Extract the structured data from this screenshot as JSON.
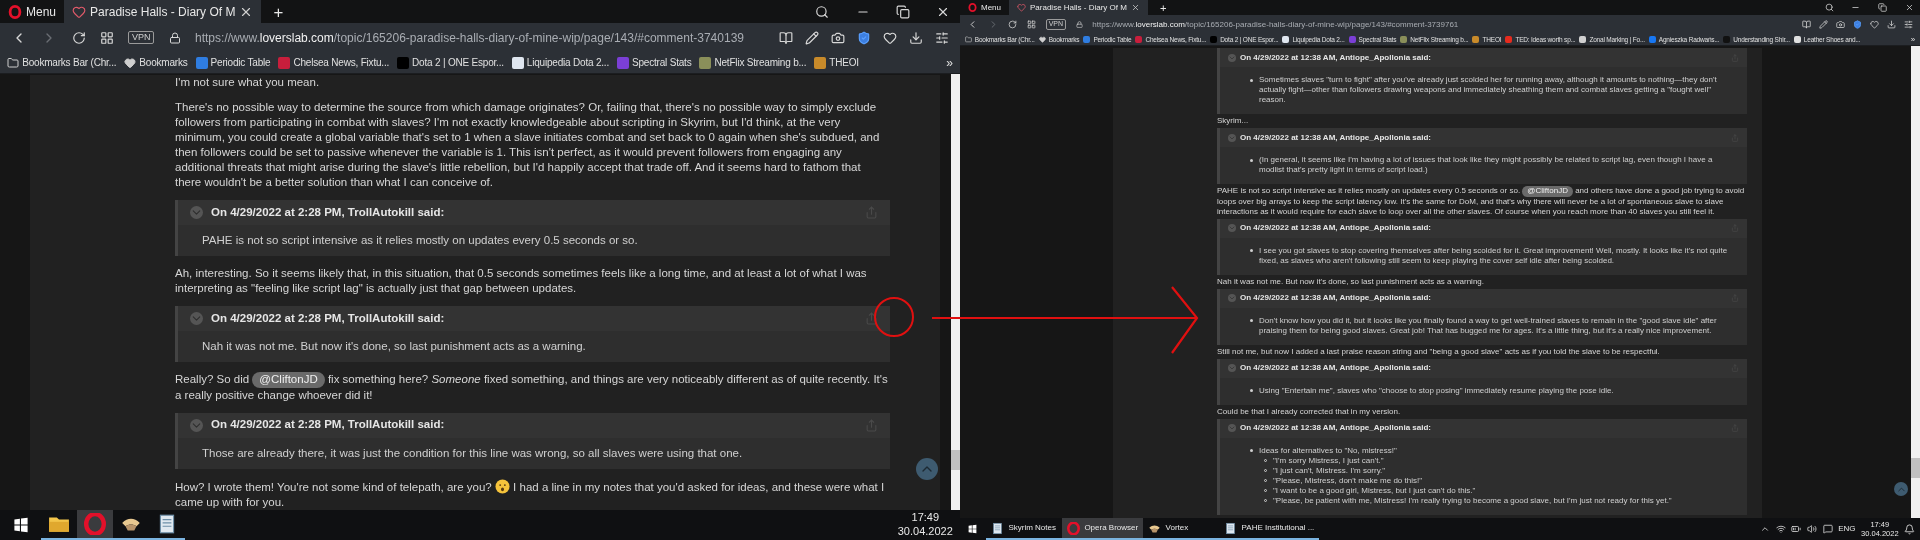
{
  "panes": [
    {
      "menu": "Menu",
      "tab": {
        "title": "Paradise Halls - Diary Of M",
        "selected": true
      },
      "new_tab": "+",
      "vpn": "VPN",
      "url": "https://www.**loverslab.com**/topic/165206-paradise-halls-diary-of-mine-wip/page/143/#comment-3740139",
      "bookmarks": [
        {
          "label": "Bookmarks Bar (Chr...",
          "kind": "folder"
        },
        {
          "label": "Bookmarks",
          "kind": "heart"
        },
        {
          "label": "Periodic Table",
          "kind": "favicon",
          "color": "#2f7de1"
        },
        {
          "label": "Chelsea News, Fixtu...",
          "kind": "favicon",
          "color": "#c81e3c"
        },
        {
          "label": "Dota 2 | ONE Espor...",
          "kind": "favicon",
          "color": "#000000"
        },
        {
          "label": "Liquipedia Dota 2...",
          "kind": "favicon",
          "color": "#dfe6ef"
        },
        {
          "label": "Spectral Stats",
          "kind": "favicon",
          "color": "#7b3fd6"
        },
        {
          "label": "NetFlix Streaming b...",
          "kind": "favicon",
          "color": "#8a8f5a"
        },
        {
          "label": "THEOI",
          "kind": "favicon",
          "color": "#c88a2a"
        }
      ],
      "more": "»",
      "content": [
        {
          "kind": "paragraph",
          "parts": [
            {
              "kind": "text",
              "text": "I'm not sure what you mean."
            }
          ]
        },
        {
          "kind": "paragraph",
          "parts": [
            {
              "kind": "text",
              "text": "There's no possible way to determine the source from which damage originates?  Or, failing that, there's no possible way to simply exclude followers from participating in combat with slaves?  I'm not exactly knowledgeable about scripting in Skyrim, but I'd think, at the very minimum, you could create a global variable that's set to 1 when a slave initiates combat and set back to 0 again when she's subdued, and then followers could be set to passive whenever the variable is 1.  This isn't perfect, as it would prevent followers from engaging any additional threats that might arise during the slave's little rebellion, but I'd happily accept that trade off.  And it seems hard to fathom that there wouldn't be a better solution than what I can conceive of."
            }
          ]
        },
        {
          "kind": "quote",
          "header": "On 4/29/2022 at 2:28 PM, TrollAutokill said:",
          "body": "PAHE is not so script intensive as it relies mostly on updates every 0.5 seconds or so."
        },
        {
          "kind": "paragraph",
          "parts": [
            {
              "kind": "text",
              "text": "Ah, interesting.  So it seems likely that, in this situation, that 0.5 seconds sometimes feels like a long time, and at least a lot of what I was interpreting as \"feeling like script lag\" is actually just that gap between updates."
            }
          ]
        },
        {
          "kind": "quote",
          "header": "On 4/29/2022 at 2:28 PM, TrollAutokill said:",
          "body": "Nah it was not me. But now it's done, so last punishment acts as a warning."
        },
        {
          "kind": "paragraph",
          "parts": [
            {
              "kind": "text",
              "text": "Really?  So did "
            },
            {
              "kind": "mention",
              "text": "@CliftonJD"
            },
            {
              "kind": "text",
              "text": " fix something here?  *Someone* fixed something, and things are very noticeably different as of quite recently.  It's a really positive change whoever did it!"
            }
          ]
        },
        {
          "kind": "quote",
          "header": "On 4/29/2022 at 2:28 PM, TrollAutokill said:",
          "body": "Those are already there, it was just the condition for this line was wrong, so all slaves were using that one."
        },
        {
          "kind": "paragraph",
          "parts": [
            {
              "kind": "text",
              "text": "How?  I wrote them!  You're not some kind of telepath, are you? "
            },
            {
              "kind": "emoji"
            },
            {
              "kind": "text",
              "text": " I had a line in my notes that you'd asked for ideas, and these were what I came up with for you."
            }
          ]
        }
      ],
      "taskbar": {
        "apps": [
          {
            "kind": "folder",
            "selected": false
          },
          {
            "kind": "opera",
            "selected": true
          },
          {
            "kind": "hat",
            "selected": false
          },
          {
            "kind": "notes",
            "selected": false
          }
        ],
        "time": "17:49",
        "date": "30.04.2022"
      }
    },
    {
      "menu": "Menu",
      "tab": {
        "title": "Paradise Halls - Diary Of M",
        "selected": true
      },
      "new_tab": "+",
      "vpn": "VPN",
      "url": "https://www.**loverslab.com**/topic/165206-paradise-halls-diary-of-mine-wip/page/143/#comment-3739761",
      "bookmarks": [
        {
          "label": "Bookmarks Bar (Chr...",
          "kind": "folder"
        },
        {
          "label": "Bookmarks",
          "kind": "heart"
        },
        {
          "label": "Periodic Table",
          "kind": "favicon",
          "color": "#2f7de1"
        },
        {
          "label": "Chelsea News, Fixtu...",
          "kind": "favicon",
          "color": "#c81e3c"
        },
        {
          "label": "Dota 2 | ONE Espor...",
          "kind": "favicon",
          "color": "#000000"
        },
        {
          "label": "Liquipedia Dota 2...",
          "kind": "favicon",
          "color": "#dfe6ef"
        },
        {
          "label": "Spectral Stats",
          "kind": "favicon",
          "color": "#7b3fd6"
        },
        {
          "label": "NetFlix Streaming b...",
          "kind": "favicon",
          "color": "#8a8f5a"
        },
        {
          "label": "THEOI",
          "kind": "favicon",
          "color": "#c88a2a"
        },
        {
          "label": "TED: Ideas worth sp...",
          "kind": "favicon",
          "color": "#e62b1e"
        },
        {
          "label": "Zonal Marking | Fo...",
          "kind": "favicon",
          "color": "#d0d0d0"
        },
        {
          "label": "Agnieszka Radwańs...",
          "kind": "favicon",
          "color": "#1877f2"
        },
        {
          "label": "Understanding Shir...",
          "kind": "favicon",
          "color": "#111111"
        },
        {
          "label": "Leather Shoes and...",
          "kind": "favicon",
          "color": "#e0e0e0"
        }
      ],
      "more": "»",
      "content": [
        {
          "kind": "quote",
          "header": "On 4/29/2022 at 12:38 AM, Antiope_Apollonia said:",
          "bullets": [
            {
              "text": "Sometimes slaves \"turn to fight\" after you've already just scolded her for running away, although it amounts to nothing—they don't actually fight—other than followers drawing weapons and immediately sheathing them and combat slaves getting a \"fought well\" reason."
            }
          ]
        },
        {
          "kind": "paragraph",
          "parts": [
            {
              "kind": "text",
              "text": "Skyrim..."
            }
          ]
        },
        {
          "kind": "quote",
          "header": "On 4/29/2022 at 12:38 AM, Antiope_Apollonia said:",
          "bullets": [
            {
              "text": "(In general, it seems like I'm having a lot of issues that look like they might possibly be related to script lag, even though I have a modlist that's pretty light in terms of script load.)"
            }
          ]
        },
        {
          "kind": "paragraph",
          "parts": [
            {
              "kind": "text",
              "text": "PAHE is not so script intensive as it relies mostly on updates every 0.5 seconds or so. "
            },
            {
              "kind": "mention",
              "text": "@CliftonJD"
            },
            {
              "kind": "text",
              "text": " and others have done a good job trying to avoid loops over big arrays to keep the script latency low. It's the same for DoM, and that's why there will never be a lot of spontaneous slave to slave interactions as it would require for each slave to loop over all the other slaves. Of course when you reach more than 40 slaves you still feel it."
            }
          ]
        },
        {
          "kind": "quote",
          "header": "On 4/29/2022 at 12:38 AM, Antiope_Apollonia said:",
          "bullets": [
            {
              "text": "I see you got slaves to stop covering themselves after being scolded for it.  Great improvement!  Well, mostly.  It looks like it's not quite fixed, as slaves who aren't following still seem to keep playing the cover self idle after being scolded."
            }
          ]
        },
        {
          "kind": "paragraph",
          "parts": [
            {
              "kind": "text",
              "text": "Nah it was not me. But now it's done, so last punishment acts as a warning."
            }
          ]
        },
        {
          "kind": "quote",
          "header": "On 4/29/2022 at 12:38 AM, Antiope_Apollonia said:",
          "bullets": [
            {
              "text": "Don't know how you did it, but it looks like you finally found a way to get well-trained slaves to remain in the \"good slave idle\" after praising them for being good slaves.  Great job!  That has bugged me for ages.  It's a little thing, but it's a really nice improvement."
            }
          ]
        },
        {
          "kind": "paragraph",
          "parts": [
            {
              "kind": "text",
              "text": "Still not me, but now I added a last praise reason string and \"being a good slave\" acts as if you told the slave to be respectful."
            }
          ]
        },
        {
          "kind": "quote",
          "header": "On 4/29/2022 at 12:38 AM, Antiope_Apollonia said:",
          "bullets": [
            {
              "text": "Using \"Entertain me\", slaves who \"choose to stop posing\" immediately resume playing the pose idle."
            }
          ]
        },
        {
          "kind": "paragraph",
          "parts": [
            {
              "kind": "text",
              "text": "Could be that I already corrected that in my version."
            }
          ]
        },
        {
          "kind": "quote",
          "header": "On 4/29/2022 at 12:38 AM, Antiope_Apollonia said:",
          "bullets": [
            {
              "text": "Ideas for alternatives to \"No, mistress!\"",
              "children": [
                {
                  "text": "\"I'm sorry Mistress, I just can't.\""
                },
                {
                  "text": "\"I just can't, Mistress.  I'm sorry.\""
                },
                {
                  "text": "\"Please, Mistress, don't make me do this!\""
                },
                {
                  "text": "\"I want to be a good girl, Mistress, but I just can't do this.\""
                },
                {
                  "text": "\"Please, be patient with me, Mistress!  I'm really trying to become a good slave, but I'm just not ready for this yet.\""
                }
              ]
            }
          ]
        }
      ],
      "taskbar": {
        "apps": [
          {
            "kind": "notes",
            "label": "Skyrim Notes",
            "selected": false
          },
          {
            "kind": "opera",
            "label": "Opera Browser",
            "selected": true
          },
          {
            "kind": "hat",
            "label": "Vortex",
            "selected": false
          },
          {
            "kind": "notes",
            "label": "PAHE Institutional ...",
            "selected": false
          }
        ],
        "language": "ENG",
        "time": "17:49",
        "date": "30.04.2022"
      }
    }
  ]
}
